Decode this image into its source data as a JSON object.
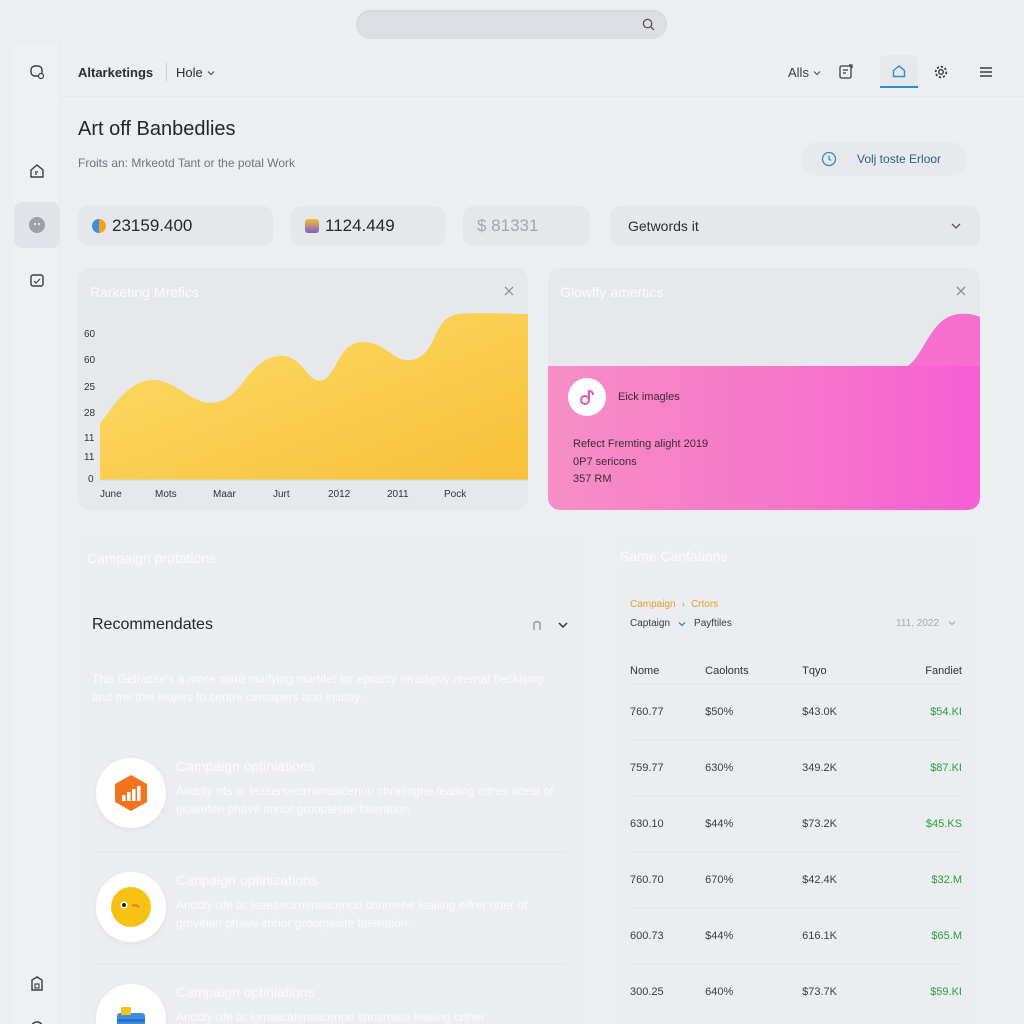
{
  "header": {
    "brand": "Altarketings",
    "crumb": "Hole",
    "all_label": "Alls"
  },
  "page": {
    "title": "Art off Banbedlies",
    "subtitle": "Froits an: Mrkeotd Tant or the potal Work",
    "cta_label": "Volj toste Erloor"
  },
  "stats": [
    {
      "value": "23159.400"
    },
    {
      "value": "1124.449"
    },
    {
      "value": "$ 81331"
    }
  ],
  "dropdown": {
    "value": "Getwords it"
  },
  "marketing_card": {
    "title": "Rarketing Mrefics",
    "y_ticks": [
      "60",
      "60",
      "25",
      "28",
      "11",
      "11",
      "0"
    ],
    "x_ticks": [
      "June",
      "Mots",
      "Maar",
      "Jurt",
      "2012",
      "2011",
      "Pock"
    ]
  },
  "growth_card": {
    "title": "Glowffy amertics",
    "label": "Eick imagles",
    "lines": [
      "Refect Fremting alight 2019",
      "0P7 sericons",
      "357 RM"
    ]
  },
  "campaign_card": {
    "title": "Campaign protations",
    "rec_title": "Recommendates",
    "rec_desc": "This Gelracse's a more niard maifying martifet for epracty reradigoy nternat beckising and me thel wojers to centre cemapers and intiday.",
    "options": [
      {
        "title": "Campaign optiniations",
        "desc": "Anddiy ofs ar leasersecirnimaliicenou chraimghe leailing crther ocest of glowefen phave imrior grooptesite fateration."
      },
      {
        "title": "Canpaign optinizations",
        "desc": "Anddiy ofe ar leaesecirnimalicenou chrimehe leailing eifrer orter of grovelen phave imrior grooptesite fateration."
      },
      {
        "title": "Campaign optiniations",
        "desc": "Anddiy ofe ar lomalicalimalicenpe shraimate leailing crther"
      }
    ]
  },
  "sales_card": {
    "title": "Same Canfations",
    "tabs_a": [
      "Campaign",
      "›",
      "Crtors"
    ],
    "tabs_b": [
      "Captaign",
      "Payftiles"
    ],
    "date": "111, 2022",
    "columns": [
      "Nome",
      "Caolonts",
      "Tqyo",
      "Fandiet"
    ],
    "rows": [
      [
        "760.77",
        "$50%",
        "$43.0K",
        "$54.KI"
      ],
      [
        "759.77",
        "630%",
        "349.2K",
        "$87.KI"
      ],
      [
        "630.10",
        "$44%",
        "$73.2K",
        "$45.KS"
      ],
      [
        "760.70",
        "670%",
        "$42.4K",
        "$32.M"
      ],
      [
        "600.73",
        "$44%",
        "616.1K",
        "$65.M"
      ],
      [
        "300.25",
        "640%",
        "$73.7K",
        "$59.KI"
      ]
    ]
  }
}
